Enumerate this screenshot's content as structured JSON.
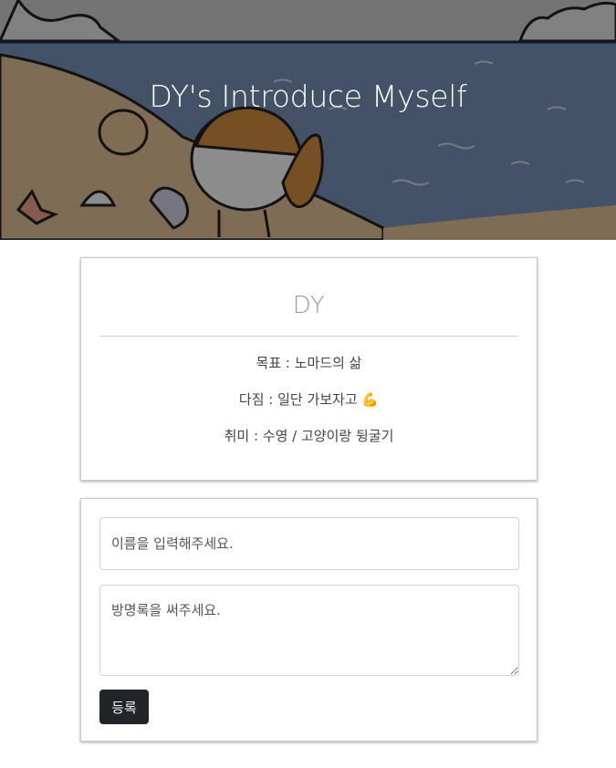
{
  "header": {
    "title": "DY's Introduce Myself"
  },
  "profile": {
    "name": "DY",
    "lines": [
      "목표 : 노마드의 삶",
      "다짐 : 일단 가보자고 💪",
      "취미 : 수영 / 고양이랑 뒹굴기"
    ]
  },
  "form": {
    "name_placeholder": "이름을 입력해주세요.",
    "comment_placeholder": "방명록을 써주세요.",
    "submit_label": "등록"
  },
  "colors": {
    "overlay": "#000000",
    "sea": "#6d86ad",
    "sand": "#d9b68a",
    "button": "#212529"
  }
}
